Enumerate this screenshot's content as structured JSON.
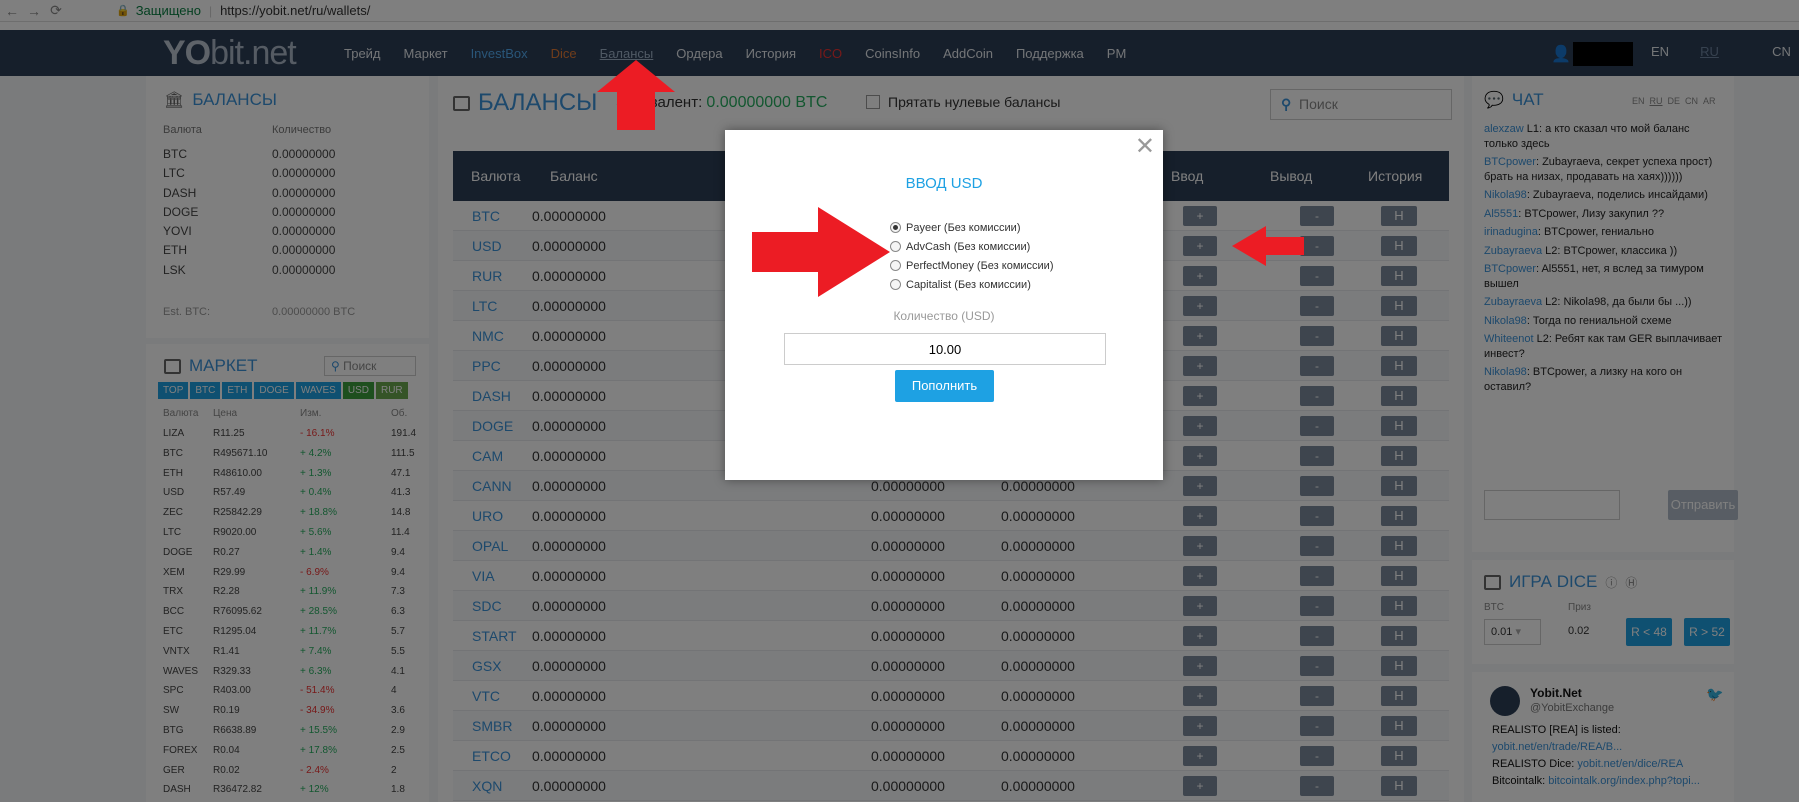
{
  "browser": {
    "secure_label": "Защищено",
    "url": "https://yobit.net/ru/wallets/"
  },
  "brand": {
    "logo_yo": "YO",
    "logo_rest": "bit.net"
  },
  "nav": {
    "items": [
      {
        "label": "Трейд"
      },
      {
        "label": "Маркет"
      },
      {
        "label": "InvestBox"
      },
      {
        "label": "Dice"
      },
      {
        "label": "Балансы"
      },
      {
        "label": "Ордера"
      },
      {
        "label": "История"
      },
      {
        "label": "ICO"
      },
      {
        "label": "CoinsInfo"
      },
      {
        "label": "AddCoin"
      },
      {
        "label": "Поддержка"
      },
      {
        "label": "PM"
      }
    ],
    "langs": [
      "EN",
      "RU",
      "CN"
    ]
  },
  "left": {
    "balances_title": "БАЛАНСЫ",
    "col_currency": "Валюта",
    "col_amount": "Количество",
    "rows": [
      {
        "c": "BTC",
        "v": "0.00000000"
      },
      {
        "c": "LTC",
        "v": "0.00000000"
      },
      {
        "c": "DASH",
        "v": "0.00000000"
      },
      {
        "c": "DOGE",
        "v": "0.00000000"
      },
      {
        "c": "YOVI",
        "v": "0.00000000"
      },
      {
        "c": "ETH",
        "v": "0.00000000"
      },
      {
        "c": "LSK",
        "v": "0.00000000"
      }
    ],
    "est_label": "Est. BTC:",
    "est_value": "0.00000000 BTC",
    "market_title": "МАРКЕТ",
    "market_search": "Поиск",
    "market_tabs": [
      "TOP",
      "BTC",
      "ETH",
      "DOGE",
      "WAVES",
      "USD",
      "RUR"
    ],
    "market_cols": [
      "Валюта",
      "Цена",
      "Изм.",
      "Об."
    ],
    "market_rows": [
      {
        "c": "LIZA",
        "p": "R11.25",
        "ch": "- 16.1%",
        "up": false,
        "v": "191.4"
      },
      {
        "c": "BTC",
        "p": "R495671.10",
        "ch": "+ 4.2%",
        "up": true,
        "v": "111.5"
      },
      {
        "c": "ETH",
        "p": "R48610.00",
        "ch": "+ 1.3%",
        "up": true,
        "v": "47.1"
      },
      {
        "c": "USD",
        "p": "R57.49",
        "ch": "+ 0.4%",
        "up": true,
        "v": "41.3"
      },
      {
        "c": "ZEC",
        "p": "R25842.29",
        "ch": "+ 18.8%",
        "up": true,
        "v": "14.8"
      },
      {
        "c": "LTC",
        "p": "R9020.00",
        "ch": "+ 5.6%",
        "up": true,
        "v": "11.4"
      },
      {
        "c": "DOGE",
        "p": "R0.27",
        "ch": "+ 1.4%",
        "up": true,
        "v": "9.4"
      },
      {
        "c": "XEM",
        "p": "R29.99",
        "ch": "- 6.9%",
        "up": false,
        "v": "9.4"
      },
      {
        "c": "TRX",
        "p": "R2.28",
        "ch": "+ 11.9%",
        "up": true,
        "v": "7.3"
      },
      {
        "c": "BCC",
        "p": "R76095.62",
        "ch": "+ 28.5%",
        "up": true,
        "v": "6.3"
      },
      {
        "c": "ETC",
        "p": "R1295.04",
        "ch": "+ 11.7%",
        "up": true,
        "v": "5.7"
      },
      {
        "c": "VNTX",
        "p": "R1.41",
        "ch": "+ 7.4%",
        "up": true,
        "v": "5.5"
      },
      {
        "c": "WAVES",
        "p": "R329.33",
        "ch": "+ 6.3%",
        "up": true,
        "v": "4.1"
      },
      {
        "c": "SPC",
        "p": "R403.00",
        "ch": "- 51.4%",
        "up": false,
        "v": "4"
      },
      {
        "c": "SW",
        "p": "R0.19",
        "ch": "- 34.9%",
        "up": false,
        "v": "3.6"
      },
      {
        "c": "BTG",
        "p": "R6638.89",
        "ch": "+ 15.5%",
        "up": true,
        "v": "2.9"
      },
      {
        "c": "FOREX",
        "p": "R0.04",
        "ch": "+ 17.8%",
        "up": true,
        "v": "2.5"
      },
      {
        "c": "GER",
        "p": "R0.02",
        "ch": "- 2.4%",
        "up": false,
        "v": "2"
      },
      {
        "c": "DASH",
        "p": "R36472.82",
        "ch": "+ 12%",
        "up": true,
        "v": "1.8"
      }
    ]
  },
  "center": {
    "title": "БАЛАНСЫ",
    "equiv_label": "Эквивалент:",
    "equiv_value": "0.00000000 BTC",
    "hide_zero": "Прятать нулевые балансы",
    "search": "Поиск",
    "cols": {
      "currency": "Валюта",
      "balance": "Баланс",
      "in": "Ввод",
      "out": "Вывод",
      "hist": "История"
    },
    "rows": [
      {
        "c": "BTC",
        "b": "0.00000000",
        "p": "",
        "r": ""
      },
      {
        "c": "USD",
        "b": "0.00000000",
        "p": "",
        "r": ""
      },
      {
        "c": "RUR",
        "b": "0.00000000",
        "p": "",
        "r": ""
      },
      {
        "c": "LTC",
        "b": "0.00000000",
        "p": "",
        "r": ""
      },
      {
        "c": "NMC",
        "b": "0.00000000",
        "p": "",
        "r": ""
      },
      {
        "c": "PPC",
        "b": "0.00000000",
        "p": "",
        "r": ""
      },
      {
        "c": "DASH",
        "b": "0.00000000",
        "p": "",
        "r": ""
      },
      {
        "c": "DOGE",
        "b": "0.00000000",
        "p": "",
        "r": ""
      },
      {
        "c": "CAM",
        "b": "0.00000000",
        "p": "",
        "r": ""
      },
      {
        "c": "CANN",
        "b": "0.00000000",
        "p": "0.00000000",
        "r": "0.00000000"
      },
      {
        "c": "URO",
        "b": "0.00000000",
        "p": "0.00000000",
        "r": "0.00000000"
      },
      {
        "c": "OPAL",
        "b": "0.00000000",
        "p": "0.00000000",
        "r": "0.00000000"
      },
      {
        "c": "VIA",
        "b": "0.00000000",
        "p": "0.00000000",
        "r": "0.00000000"
      },
      {
        "c": "SDC",
        "b": "0.00000000",
        "p": "0.00000000",
        "r": "0.00000000"
      },
      {
        "c": "START",
        "b": "0.00000000",
        "p": "0.00000000",
        "r": "0.00000000"
      },
      {
        "c": "GSX",
        "b": "0.00000000",
        "p": "0.00000000",
        "r": "0.00000000"
      },
      {
        "c": "VTC",
        "b": "0.00000000",
        "p": "0.00000000",
        "r": "0.00000000"
      },
      {
        "c": "SMBR",
        "b": "0.00000000",
        "p": "0.00000000",
        "r": "0.00000000"
      },
      {
        "c": "ETCO",
        "b": "0.00000000",
        "p": "0.00000000",
        "r": "0.00000000"
      },
      {
        "c": "XQN",
        "b": "0.00000000",
        "p": "0.00000000",
        "r": "0.00000000"
      }
    ],
    "btn_plus": "+",
    "btn_minus": "-",
    "btn_hist": "H"
  },
  "chat": {
    "title": "ЧАТ",
    "langs": [
      "EN",
      "RU",
      "DE",
      "CN",
      "AR"
    ],
    "messages": [
      {
        "u": "alexzaw",
        "t": " L1: а кто сказал что мой баланс только здесь"
      },
      {
        "u": "BTCpower",
        "t": ": Zubayraeva, секрет успеха прост) брать на низах, продавать на хаях))))))"
      },
      {
        "u": "Nikola98",
        "t": ": Zubayraeva, поделись инсайдами)"
      },
      {
        "u": "Al5551",
        "t": ": BTCpower, Лизу закупил ??"
      },
      {
        "u": "irinadugina",
        "t": ": BTCpower, гениально"
      },
      {
        "u": "Zubayraeva",
        "t": " L2: BTCpower, классика ))"
      },
      {
        "u": "BTCpower",
        "t": ": Al5551, нет, я вслед за тимуром вышел"
      },
      {
        "u": "Zubayraeva",
        "t": " L2: Nikola98, да были бы ...))"
      },
      {
        "u": "Nikola98",
        "t": ": Тогда по гениальной схеме"
      },
      {
        "u": "Whiteenot",
        "t": " L2: Ребят как там GER выплачивает инвест?"
      },
      {
        "u": "Nikola98",
        "t": ": BTCpower, а лизку на кого он оставил?"
      }
    ],
    "send": "Отправить",
    "dice_title": "ИГРА DICE",
    "dice_btc_label": "BTC",
    "dice_prize_label": "Приз",
    "dice_bet": "0.01",
    "dice_prize": "0.02",
    "dice_lo": "R < 48",
    "dice_hi": "R > 52",
    "tw_name": "Yobit.Net",
    "tw_handle": "@YobitExchange",
    "tw_line1": "REALISTO [REA] is listed:",
    "tw_link1": "yobit.net/en/trade/REA/B...",
    "tw_line2": "REALISTO Dice: ",
    "tw_link2": "yobit.net/en/dice/REA",
    "tw_line3": "Bitcointalk: ",
    "tw_link3": "bitcointalk.org/index.php?topi..."
  },
  "modal": {
    "title": "ВВОД USD",
    "options": [
      {
        "label": "Payeer (Без комиссии)",
        "checked": true
      },
      {
        "label": "AdvCash (Без комиссии)",
        "checked": false
      },
      {
        "label": "PerfectMoney (Без комиссии)",
        "checked": false
      },
      {
        "label": "Capitalist (Без комиссии)",
        "checked": false
      }
    ],
    "amount_label": "Количество (USD)",
    "amount_value": "10.00",
    "submit": "Пополнить"
  },
  "colors": {
    "accent": "#1ea1e3",
    "navbar": "#2c3e56",
    "link": "#3b92d9",
    "arrow": "#ec1c24"
  }
}
